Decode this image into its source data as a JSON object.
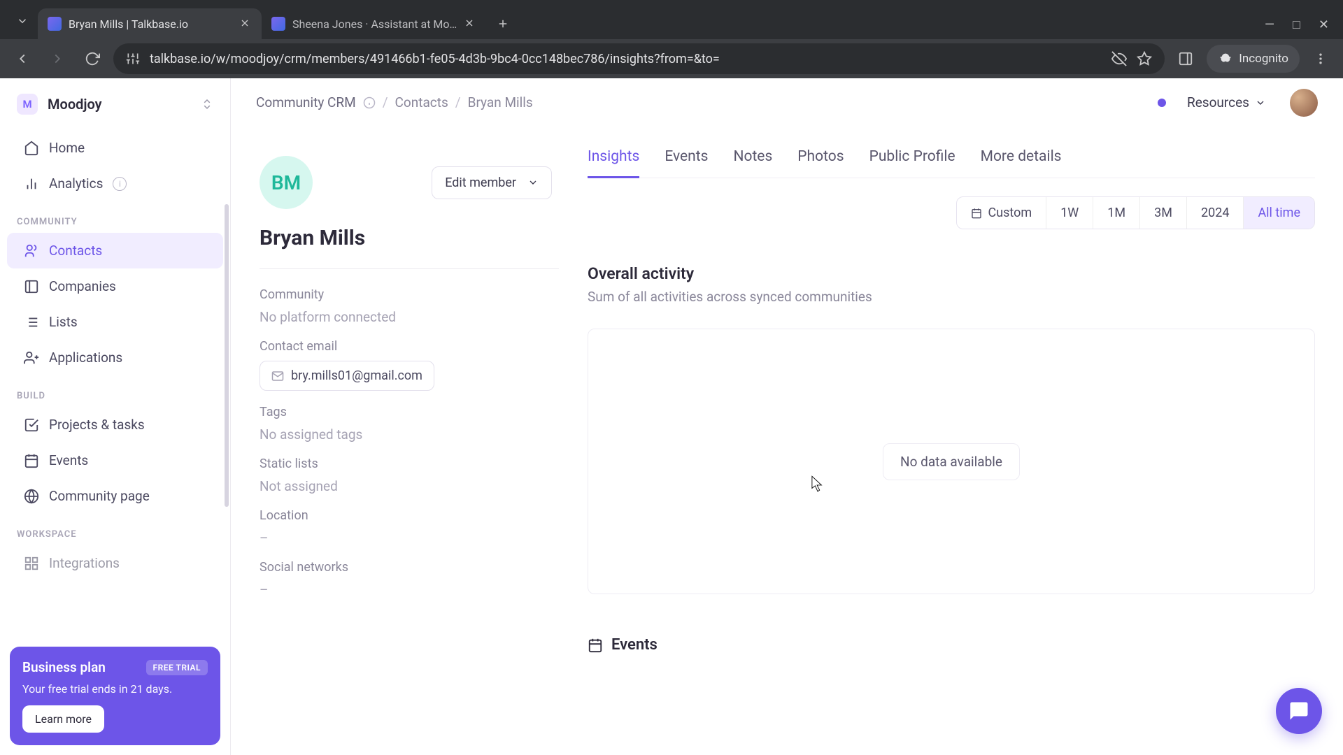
{
  "browser": {
    "tabs": [
      {
        "title": "Bryan Mills | Talkbase.io"
      },
      {
        "title": "Sheena Jones · Assistant at Mo…"
      }
    ],
    "url": "talkbase.io/w/moodjoy/crm/members/491466b1-fe05-4d3b-9bc4-0cc148bec786/insights?from=&to=",
    "incognito_label": "Incognito"
  },
  "workspace": {
    "badge": "M",
    "name": "Moodjoy"
  },
  "sidebar": {
    "items_top": [
      {
        "icon": "home-icon",
        "label": "Home"
      },
      {
        "icon": "analytics-icon",
        "label": "Analytics",
        "info": true
      }
    ],
    "section_community": "COMMUNITY",
    "items_community": [
      {
        "icon": "contacts-icon",
        "label": "Contacts",
        "active": true
      },
      {
        "icon": "companies-icon",
        "label": "Companies"
      },
      {
        "icon": "lists-icon",
        "label": "Lists"
      },
      {
        "icon": "applications-icon",
        "label": "Applications"
      }
    ],
    "section_build": "BUILD",
    "items_build": [
      {
        "icon": "projects-icon",
        "label": "Projects & tasks"
      },
      {
        "icon": "events-icon",
        "label": "Events"
      },
      {
        "icon": "community-page-icon",
        "label": "Community page"
      }
    ],
    "section_workspace": "WORKSPACE",
    "items_workspace": [
      {
        "icon": "integrations-icon",
        "label": "Integrations"
      }
    ]
  },
  "promo": {
    "title": "Business plan",
    "badge": "FREE TRIAL",
    "subtitle": "Your free trial ends in 21 days.",
    "cta": "Learn more"
  },
  "breadcrumb": {
    "root": "Community CRM",
    "mid": "Contacts",
    "leaf": "Bryan Mills"
  },
  "header": {
    "resources": "Resources"
  },
  "member": {
    "initials": "BM",
    "edit_label": "Edit member",
    "name": "Bryan Mills",
    "fields": {
      "community_label": "Community",
      "community_value": "No platform connected",
      "email_label": "Contact email",
      "email_value": "bry.mills01@gmail.com",
      "tags_label": "Tags",
      "tags_value": "No assigned tags",
      "lists_label": "Static lists",
      "lists_value": "Not assigned",
      "location_label": "Location",
      "location_value": "–",
      "social_label": "Social networks",
      "social_value": "–"
    }
  },
  "subtabs": [
    "Insights",
    "Events",
    "Notes",
    "Photos",
    "Public Profile",
    "More details"
  ],
  "ranges": [
    "Custom",
    "1W",
    "1M",
    "3M",
    "2024",
    "All time"
  ],
  "activity": {
    "title": "Overall activity",
    "subtitle": "Sum of all activities across synced communities",
    "empty": "No data available"
  },
  "events_heading": "Events"
}
